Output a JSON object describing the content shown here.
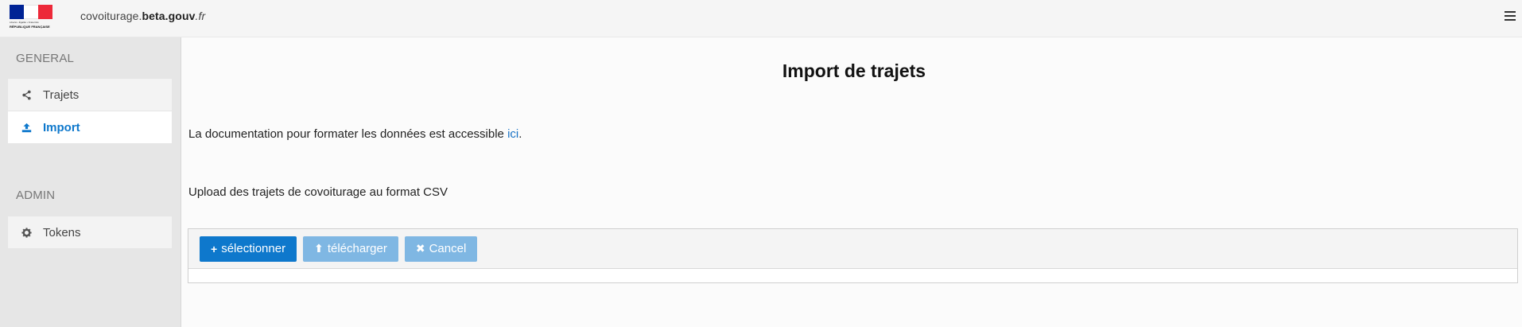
{
  "header": {
    "logo": {
      "motto": "Liberté • Égalité • Fraternité",
      "text": "RÉPUBLIQUE FRANÇAISE",
      "flag_colors": [
        "#002395",
        "#ffffff",
        "#ed2939"
      ]
    },
    "site_name": {
      "prefix": "covoiturage.",
      "bold": "beta.gouv",
      "suffix": ".fr"
    },
    "menu_icon": "hamburger-menu-icon"
  },
  "sidebar": {
    "general_title": "GENERAL",
    "general_items": [
      {
        "label": "Trajets",
        "icon": "share-icon",
        "active": false
      },
      {
        "label": "Import",
        "icon": "upload-icon",
        "active": true
      }
    ],
    "admin_title": "ADMIN",
    "admin_items": [
      {
        "label": "Tokens",
        "icon": "gear-icon",
        "active": false
      }
    ]
  },
  "main": {
    "title": "Import de trajets",
    "doc_text": "La documentation pour formater les données est accessible ",
    "doc_link": "ici",
    "doc_end": ".",
    "upload_text": "Upload des trajets de covoiturage au format CSV",
    "buttons": {
      "select": {
        "glyph": "+",
        "label": "sélectionner"
      },
      "upload": {
        "glyph": "⬆",
        "label": "télécharger"
      },
      "cancel": {
        "glyph": "✖",
        "label": "Cancel"
      }
    }
  },
  "colors": {
    "accent": "#0e78cc",
    "accent_disabled": "#7fb7e3",
    "sidebar_bg": "#e6e6e6",
    "link": "#1a73c6"
  }
}
